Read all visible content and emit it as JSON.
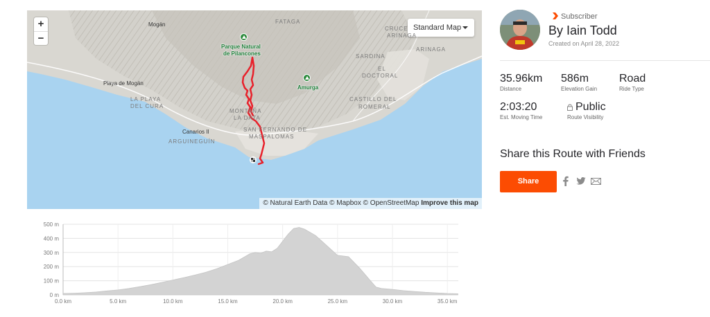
{
  "map": {
    "zoom_in": "+",
    "zoom_out": "−",
    "style_selector": "Standard Map",
    "attribution": "© Natural Earth Data © Mapbox © OpenStreetMap",
    "attribution_link": "Improve this map",
    "labels": {
      "mogan": "Mogán",
      "fatagaa": "FATAGA",
      "cruce_arinaga": "CRUCE",
      "arinaga_top": "ARINAGA",
      "arinaga": "ARINAGA",
      "park_pilancones_1": "Parque Natural",
      "park_pilancones_2": "de Pilancones",
      "sardina": "SARDINA",
      "el": "EL",
      "doctoral": "DOCTORAL",
      "playa_mogan": "Playa de Mogán",
      "amurga": "Amurga",
      "la_playa": "LA PLAYA",
      "del_cura": "DEL CURA",
      "montana": "MONTAÑA",
      "la_data": "LA DATA",
      "castillo": "CASTILLO DEL",
      "romeral": "ROMERAL",
      "canarios": "Canarios II",
      "arguineguin": "ARGUINEGUÍN",
      "san_fernando": "SAN FERNANDO DE",
      "maspalomas": "MASPALOMAS"
    }
  },
  "elevation": {
    "y_ticks": [
      "0 m",
      "100 m",
      "200 m",
      "300 m",
      "400 m",
      "500 m"
    ],
    "x_ticks": [
      "0.0 km",
      "5.0 km",
      "10.0 km",
      "15.0 km",
      "20.0 km",
      "25.0 km",
      "30.0 km",
      "35.0 km"
    ],
    "profile_km": [
      0,
      1,
      2,
      3,
      4,
      5,
      6,
      7,
      8,
      9,
      10,
      11,
      12,
      13,
      14,
      15,
      16,
      17,
      17.5,
      18,
      18.5,
      19,
      19.5,
      20,
      20.5,
      21,
      21.5,
      22,
      23,
      24,
      25,
      26,
      27,
      28,
      28.5,
      29,
      29.5,
      30,
      31,
      32,
      33,
      34,
      35,
      35.96
    ],
    "profile_m": [
      10,
      12,
      15,
      20,
      28,
      35,
      45,
      58,
      72,
      88,
      105,
      122,
      140,
      160,
      185,
      215,
      245,
      290,
      300,
      295,
      310,
      305,
      330,
      380,
      430,
      470,
      478,
      465,
      420,
      350,
      280,
      270,
      190,
      100,
      55,
      45,
      42,
      38,
      30,
      24,
      18,
      14,
      10,
      8
    ]
  },
  "author": {
    "badge": "Subscriber",
    "name": "By Iain Todd",
    "created": "Created on April 28, 2022"
  },
  "stats": {
    "distance_value": "35.96km",
    "distance_label": "Distance",
    "elevation_value": "586m",
    "elevation_label": "Elevation Gain",
    "type_value": "Road",
    "type_label": "Ride Type",
    "time_value": "2:03:20",
    "time_label": "Est. Moving Time",
    "visibility_value": "Public",
    "visibility_label": "Route Visibility"
  },
  "share": {
    "title": "Share this Route with Friends",
    "button": "Share"
  },
  "colors": {
    "brand": "#fc4c02",
    "route": "#e8202a",
    "water": "#a9d3f0",
    "land": "#d8d6d0",
    "park_green": "#2e8b3e",
    "elevation_fill": "#d3d3d3"
  },
  "icons": [
    "zoom-in-icon",
    "zoom-out-icon",
    "caret-down-icon",
    "park-icon",
    "start-finish-flag-icon",
    "subscriber-chevron-icon",
    "lock-icon",
    "facebook-icon",
    "twitter-icon",
    "email-icon"
  ]
}
